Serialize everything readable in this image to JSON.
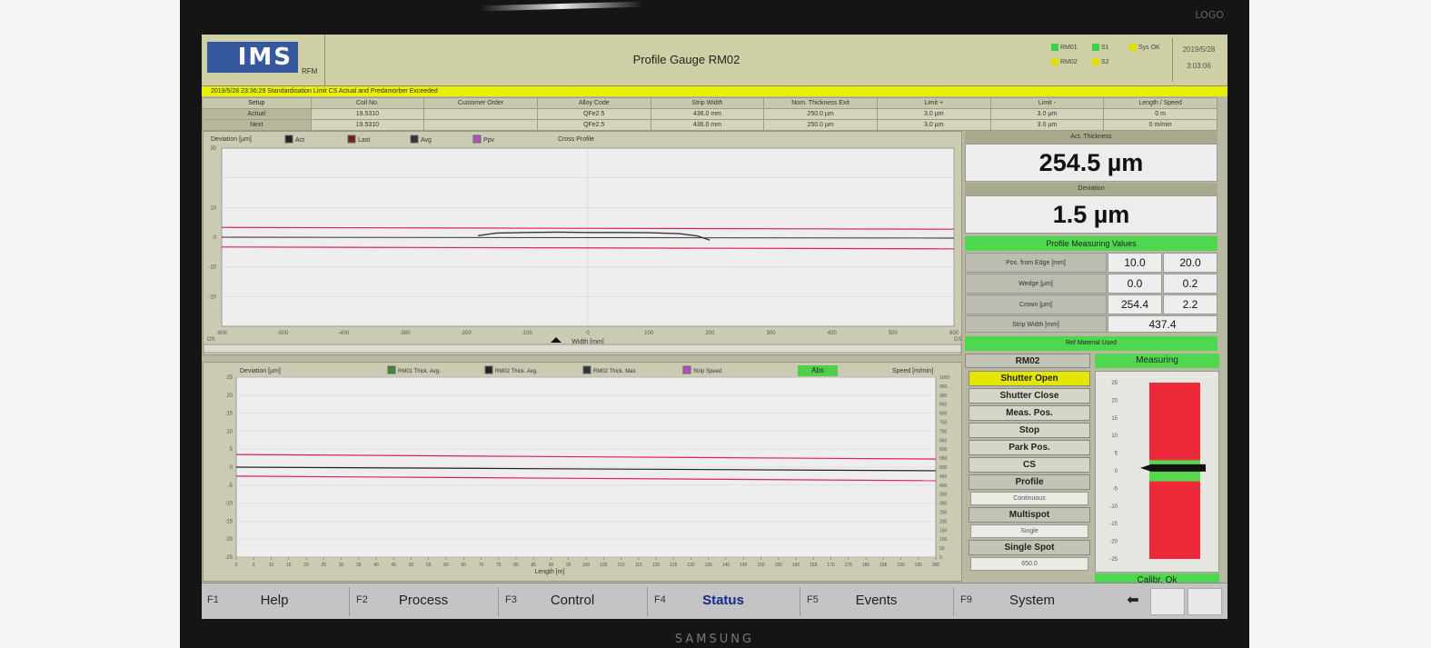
{
  "monitor": {
    "brand": "SAMSUNG",
    "corner_label": "LOGO"
  },
  "header": {
    "logo": "IMS",
    "logo_sub": "RFM",
    "title": "Profile Gauge RM02",
    "legend": [
      {
        "label": "RM01",
        "color": "#3ad24a"
      },
      {
        "label": "RM02",
        "color": "#e0e000"
      },
      {
        "label": "S1",
        "color": "#3ad24a"
      },
      {
        "label": "S2",
        "color": "#e0e000"
      },
      {
        "label": "Sys OK",
        "color": "#e0e000"
      }
    ],
    "date": "2019/5/28",
    "time": "3:03:06"
  },
  "status_message": "2019/5/28 23:36:29   Standardisation   Limit CS Actual and Predamorber Exceeded",
  "setup_table": {
    "headers": [
      "Setup",
      "Coil No.",
      "Customer Order",
      "Alloy Code",
      "Strip Width",
      "Nom. Thickness Exit",
      "Limit +",
      "Limit -",
      "Length / Speed"
    ],
    "rows": [
      {
        "label": "Actual",
        "cells": [
          "19.5310",
          "",
          "QFe2.5",
          "436.0 mm",
          "250.0 µm",
          "3.0 µm",
          "3.0 µm",
          "0 m"
        ]
      },
      {
        "label": "Next",
        "cells": [
          "19.5310",
          "",
          "QFe2.5",
          "436.0 mm",
          "250.0 µm",
          "3.0 µm",
          "3.0 µm",
          "0 m/min"
        ]
      }
    ]
  },
  "cross_chart": {
    "ylabel": "Deviation [µm]",
    "title": "Cross Profile",
    "xlabel": "Width [mm]",
    "legend": [
      {
        "label": "Act",
        "color": "#222222"
      },
      {
        "label": "Last",
        "color": "#702020"
      },
      {
        "label": "Avg",
        "color": "#333333"
      },
      {
        "label": "Ppv",
        "color": "#b050c0"
      }
    ],
    "xticks": [
      "-600",
      "-500",
      "-400",
      "-300",
      "-200",
      "-100",
      "0",
      "100",
      "200",
      "300",
      "400",
      "500",
      "600"
    ],
    "yticks": [
      "30",
      "10",
      "0",
      "-10",
      "-20"
    ],
    "x_side_labels": [
      "OS",
      "DS"
    ]
  },
  "length_chart": {
    "ylabel": "Deviation [µm]",
    "ylabel_right": "Speed [m/min]",
    "xlabel": "Length [m]",
    "abs_label": "Abs",
    "legend": [
      {
        "label": "RM01 Thick. Avg.",
        "color": "#3a8a3a"
      },
      {
        "label": "RM02 Thick. Avg.",
        "color": "#222222"
      },
      {
        "label": "RM02 Thick. Max",
        "color": "#333333"
      },
      {
        "label": "Strip Speed",
        "color": "#b050c0"
      }
    ],
    "yticks": [
      "25",
      "20",
      "15",
      "10",
      "5",
      "0",
      "-5",
      "-10",
      "-15",
      "-20",
      "-25"
    ],
    "speed_ticks": [
      "1000",
      "950",
      "900",
      "850",
      "800",
      "750",
      "700",
      "650",
      "600",
      "550",
      "500",
      "450",
      "400",
      "350",
      "300",
      "250",
      "200",
      "150",
      "100",
      "50",
      "0"
    ],
    "xticks": [
      "0",
      "5",
      "10",
      "15",
      "20",
      "25",
      "30",
      "35",
      "40",
      "45",
      "50",
      "55",
      "60",
      "65",
      "70",
      "75",
      "80",
      "85",
      "90",
      "95",
      "100",
      "105",
      "110",
      "115",
      "120",
      "125",
      "130",
      "135",
      "140",
      "145",
      "150",
      "155",
      "160",
      "165",
      "170",
      "175",
      "180",
      "185",
      "190",
      "195",
      "200"
    ]
  },
  "chart_data": [
    {
      "type": "line",
      "title": "Cross Profile",
      "xlabel": "Width [mm]",
      "ylabel": "Deviation [µm]",
      "xlim": [
        -600,
        600
      ],
      "ylim": [
        -30,
        30
      ],
      "limits": {
        "upper": 3.0,
        "lower": -3.0,
        "color": "#e0205a"
      },
      "series": [
        {
          "name": "Act",
          "x": [
            -180,
            -150,
            -100,
            -50,
            0,
            50,
            100,
            150,
            180,
            200
          ],
          "y": [
            0.5,
            1.4,
            1.6,
            1.7,
            1.6,
            1.6,
            1.5,
            1.2,
            0.4,
            -1.0
          ]
        }
      ]
    },
    {
      "type": "line",
      "xlabel": "Length [m]",
      "ylabel": "Deviation [µm]",
      "xlim": [
        0,
        200
      ],
      "ylim": [
        -25,
        25
      ],
      "limits": {
        "upper": 3.0,
        "lower": -3.0,
        "color": "#e0205a"
      },
      "series": [
        {
          "name": "RM02 Thick. Avg.",
          "x": [
            0,
            200
          ],
          "y": [
            0,
            -1.0
          ]
        }
      ]
    }
  ],
  "right_panel": {
    "act_thickness_label": "Act. Thickness",
    "act_thickness_value": "254.5 µm",
    "deviation_label": "Deviation",
    "deviation_value": "1.5 µm",
    "measuring_values_title": "Profile Measuring Values",
    "measuring_values": [
      {
        "label": "Pos. from Edge [mm]",
        "v1": "10.0",
        "v2": "20.0"
      },
      {
        "label": "Wedge [µm]",
        "v1": "0.0",
        "v2": "0.2"
      },
      {
        "label": "Crown [µm]",
        "v1": "254.4",
        "v2": "2.2"
      }
    ],
    "strip_width_label": "Strip Width [mm]",
    "strip_width_value": "437.4",
    "ref_material": "Ref Material Used",
    "rm_label": "RM02",
    "measuring_label": "Measuring",
    "buttons": [
      "Shutter Open",
      "Shutter Close",
      "Meas. Pos.",
      "Stop",
      "Park Pos.",
      "CS"
    ],
    "profile_label": "Profile",
    "profile_value": "Continuous",
    "multispot_label": "Multispot",
    "multispot_value": "Single",
    "singlespot_label": "Single Spot",
    "singlespot_value": "650.0",
    "gauge_ticks": [
      "25",
      "20",
      "15",
      "10",
      "5",
      "0",
      "-5",
      "-10",
      "-15",
      "-20",
      "-25"
    ],
    "gauge_value": 0.8,
    "gauge_ok_band": [
      -3,
      3
    ],
    "calib_label": "Calibr. Ok"
  },
  "fkeys": [
    {
      "num": "F1",
      "label": "Help"
    },
    {
      "num": "F2",
      "label": "Process"
    },
    {
      "num": "F3",
      "label": "Control"
    },
    {
      "num": "F4",
      "label": "Status"
    },
    {
      "num": "F5",
      "label": "Events"
    },
    {
      "num": "F9",
      "label": "System"
    }
  ]
}
